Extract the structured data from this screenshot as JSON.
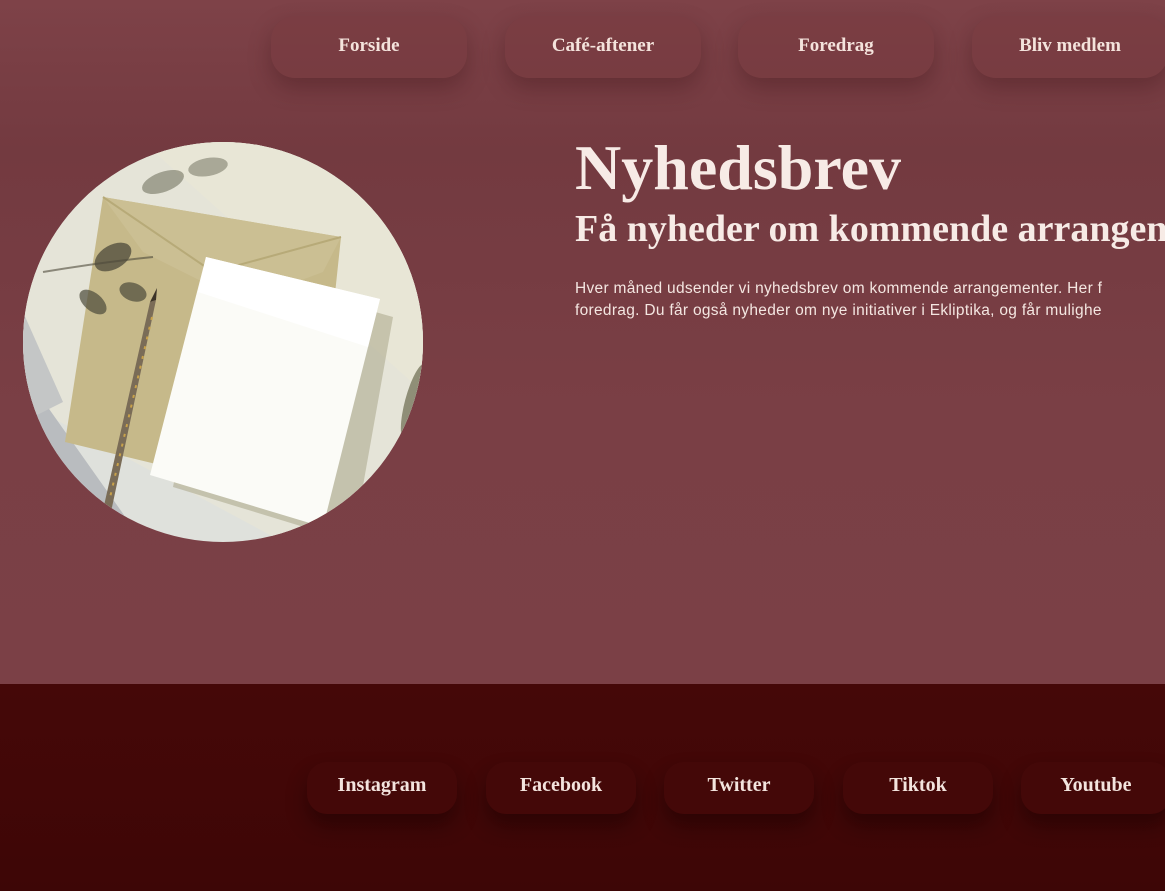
{
  "nav": {
    "items": [
      {
        "label": "Forside"
      },
      {
        "label": "Café-aftener"
      },
      {
        "label": "Foredrag"
      },
      {
        "label": "Bliv medlem"
      }
    ]
  },
  "hero": {
    "title": "Nyhedsbrev",
    "subtitle": "Få nyheder om kommende arrangen",
    "body_line_1": "Hver måned udsender vi nyhedsbrev om kommende arrangementer. Her f",
    "body_line_2": "foredrag. Du får også nyheder om nye initiativer i Ekliptika, og får mulighe"
  },
  "footer": {
    "links": [
      {
        "label": "Instagram"
      },
      {
        "label": "Facebook"
      },
      {
        "label": "Twitter"
      },
      {
        "label": "Tiktok"
      },
      {
        "label": "Youtube"
      }
    ]
  },
  "colors": {
    "page_background": "#7a3f45",
    "footer_background": "#420707",
    "text": "#f7ebe6"
  },
  "icons": {
    "hero_image": "envelope-letter-pencil-photo"
  }
}
